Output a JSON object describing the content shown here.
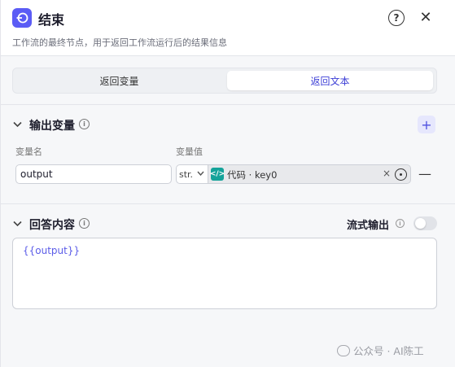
{
  "header": {
    "title": "结束",
    "description": "工作流的最终节点，用于返回工作流运行后的结果信息",
    "help_glyph": "?",
    "close_glyph": "✕"
  },
  "tabs": [
    {
      "label": "返回变量",
      "active": false
    },
    {
      "label": "返回文本",
      "active": true
    }
  ],
  "output_section": {
    "title": "输出变量",
    "column_name": "变量名",
    "column_value": "变量值",
    "rows": [
      {
        "name": "output",
        "type": "str.",
        "ref_text": "代码 · key0"
      }
    ]
  },
  "answer_section": {
    "title": "回答内容",
    "stream_label": "流式输出",
    "stream_enabled": false,
    "content": "{{output}}"
  },
  "watermark": "公众号 · AI陈工",
  "colors": {
    "accent": "#5b5cf5",
    "code_node": "#14a39a",
    "active_tab_text": "#3d3fd6"
  }
}
